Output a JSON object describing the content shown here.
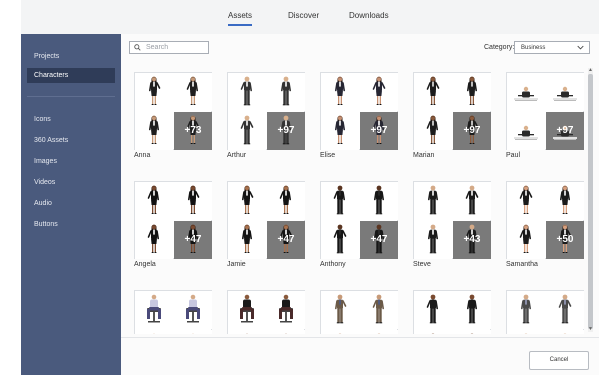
{
  "tabs": [
    {
      "label": "Assets",
      "active": true
    },
    {
      "label": "Discover",
      "active": false
    },
    {
      "label": "Downloads",
      "active": false
    }
  ],
  "sidebar": {
    "items": [
      {
        "label": "Projects",
        "active": false
      },
      {
        "label": "Characters",
        "active": true
      },
      {
        "label": "Icons",
        "active": false
      },
      {
        "label": "360 Assets",
        "active": false
      },
      {
        "label": "Images",
        "active": false
      },
      {
        "label": "Videos",
        "active": false
      },
      {
        "label": "Audio",
        "active": false
      },
      {
        "label": "Buttons",
        "active": false
      }
    ]
  },
  "search": {
    "placeholder": "Search"
  },
  "category": {
    "label": "Category:",
    "value": "Business"
  },
  "cards": [
    {
      "name": "Anna",
      "more": "+73",
      "gender": "f",
      "suit": "#1e1e1e",
      "shirt": "#ffffff",
      "skin": "#c79a78"
    },
    {
      "name": "Arthur",
      "more": "+97",
      "gender": "m",
      "suit": "#333333",
      "shirt": "#ffffff",
      "skin": "#d9b08c"
    },
    {
      "name": "Elise",
      "more": "+97",
      "gender": "f",
      "suit": "#262633",
      "shirt": "#ffffff",
      "skin": "#c69072"
    },
    {
      "name": "Marian",
      "more": "+97",
      "gender": "f",
      "suit": "#1c1c1c",
      "shirt": "#e7e7e7",
      "skin": "#8a5a3c"
    },
    {
      "name": "Paul",
      "more": "+97",
      "gender": "desk",
      "suit": "#2a2a2a",
      "shirt": "#ffffff",
      "skin": "#d9b08c"
    },
    {
      "name": "Angela",
      "more": "+47",
      "gender": "f",
      "suit": "#111111",
      "shirt": "#ffffff",
      "skin": "#7a4a30"
    },
    {
      "name": "Jamie",
      "more": "+47",
      "gender": "f",
      "suit": "#141414",
      "shirt": "#ffffff",
      "skin": "#a8714d"
    },
    {
      "name": "Anthony",
      "more": "+47",
      "gender": "m",
      "suit": "#161616",
      "shirt": "#2a2a2a",
      "skin": "#5a3521"
    },
    {
      "name": "Steve",
      "more": "+43",
      "gender": "m",
      "suit": "#1a1a1a",
      "shirt": "#ffffff",
      "skin": "#d4aa88"
    },
    {
      "name": "Samantha",
      "more": "+50",
      "gender": "f",
      "suit": "#1a1a1a",
      "shirt": "#ffffff",
      "skin": "#d7a07e"
    },
    {
      "name": "",
      "more": "",
      "gender": "sit",
      "suit": "#4a4a7a",
      "shirt": "#c7c7e0",
      "skin": "#d4aa88"
    },
    {
      "name": "",
      "more": "",
      "gender": "sit",
      "suit": "#4a2a2a",
      "shirt": "#1a1a1a",
      "skin": "#8a5a3c"
    },
    {
      "name": "",
      "more": "",
      "gender": "m",
      "suit": "#6b5a48",
      "shirt": "#4a5a8a",
      "skin": "#c79a78"
    },
    {
      "name": "",
      "more": "",
      "gender": "m",
      "suit": "#1a1a1a",
      "shirt": "#1a1a1a",
      "skin": "#7a4a30"
    },
    {
      "name": "",
      "more": "",
      "gender": "m",
      "suit": "#4a4a4a",
      "shirt": "#9aa0c0",
      "skin": "#d4aa88"
    }
  ],
  "scroll": {
    "up": "▲",
    "down": "▼"
  },
  "footer": {
    "cancel_label": "Cancel"
  },
  "colors": {
    "sidebar": "#4a5a7d",
    "sidebar_active": "#2f3c58",
    "accent": "#3a6bc4",
    "more_overlay": "#7a7a7a"
  }
}
